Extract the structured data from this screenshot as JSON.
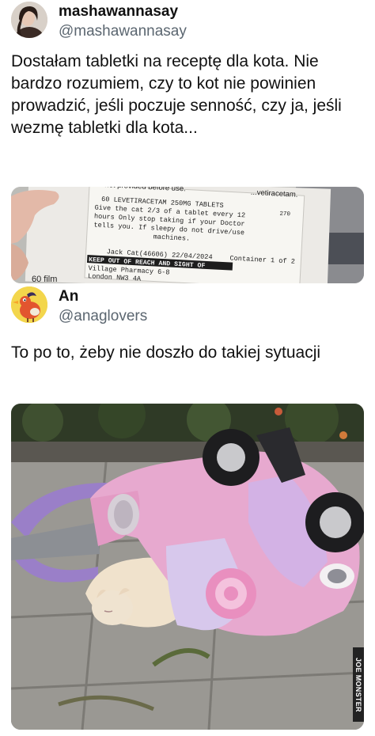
{
  "tweets": [
    {
      "name": "mashawannasay",
      "handle": "@mashawannasay",
      "text": "Dostałam tabletki na receptę dla kota. Nie bardzo rozumiem, czy to kot nie powinien prowadzić, jeśli poczuje senność, czy ja, jeśli wezmę tabletki dla kota...",
      "avatar_icon": "profile-photo",
      "photo_label": {
        "line_top_left": "...ianet provided before use.",
        "line_top_right": "...vetiracetam.",
        "drug": "60 LEVETIRACETAM 250MG TABLETS",
        "num": "270",
        "l1": "Give the cat 2/3 of a tablet every 12",
        "l2": "hours Only stop taking if your Doctor",
        "l3": "tells you. If sleepy do not drive/use",
        "l4": "machines.",
        "patient": "Jack Cat(46606) 22/04/2024",
        "container": "Container 1 of 2",
        "warning": "KEEP OUT OF REACH AND SIGHT OF",
        "pharmacy": "Village Pharmacy 6-8",
        "address": "London NW3 4A",
        "film": "60 film"
      }
    },
    {
      "name": "An",
      "handle": "@anaglovers",
      "text": "To po to, żeby nie doszło do takiej sytuacji",
      "avatar_icon": "cartoon-bird-avatar",
      "watermark": "JOE MONSTER"
    }
  ]
}
